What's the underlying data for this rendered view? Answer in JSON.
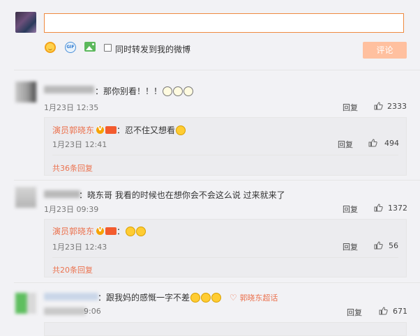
{
  "compose": {
    "input_value": "",
    "repost_label": "同时转发到我的微博",
    "submit_label": "评论",
    "icons": [
      "emoji-icon",
      "gif-icon",
      "image-icon"
    ]
  },
  "comments": [
    {
      "text": "：那你别看！！！",
      "time": "1月23日 12:35",
      "reply_label": "回复",
      "likes": "2333",
      "replies": [
        {
          "author": "演员郭晓东",
          "text": "：忍不住又想看",
          "time": "1月23日 12:41",
          "reply_label": "回复",
          "likes": "494"
        }
      ],
      "more_replies": "共36条回复"
    },
    {
      "text": "：晓东哥 我看的时候也在想你会不会这么说 过来就来了",
      "time": "1月23日 09:39",
      "reply_label": "回复",
      "likes": "1372",
      "replies": [
        {
          "author": "演员郭晓东",
          "text": "：",
          "time": "1月23日 12:43",
          "reply_label": "回复",
          "likes": "56"
        }
      ],
      "more_replies": "共20条回复"
    },
    {
      "text": "：跟我妈的感慨一字不差",
      "super_topic": "郭晓东超话",
      "time": "9:06",
      "reply_label": "回复",
      "likes": "671"
    }
  ],
  "colors": {
    "accent": "#eb7350",
    "submit_bg": "#ffc09f",
    "input_border": "#ef8a3f"
  }
}
